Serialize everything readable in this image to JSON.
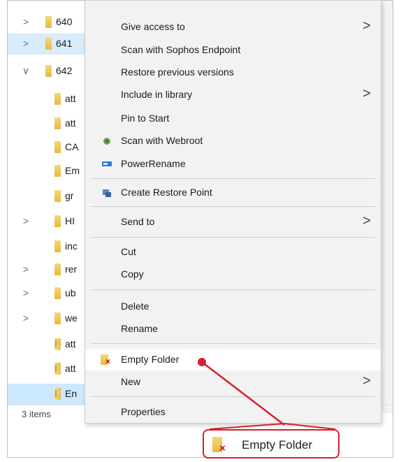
{
  "explorer": {
    "tree": [
      {
        "label": "640",
        "chevron": ">",
        "icon": "folder-icon",
        "indent": 0
      },
      {
        "label": "641",
        "chevron": ">",
        "icon": "folder-icon",
        "indent": 0
      },
      {
        "label": "642",
        "chevron": "∨",
        "icon": "folder-icon",
        "indent": 0
      },
      {
        "label": "att",
        "chevron": "",
        "icon": "folder-icon",
        "indent": 1
      },
      {
        "label": "att",
        "chevron": "",
        "icon": "folder-icon",
        "indent": 1
      },
      {
        "label": "CA",
        "chevron": "",
        "icon": "folder-icon",
        "indent": 1
      },
      {
        "label": "Em",
        "chevron": "",
        "icon": "folder-icon",
        "indent": 1
      },
      {
        "label": "gr",
        "chevron": "",
        "icon": "folder-icon",
        "indent": 1
      },
      {
        "label": "HI",
        "chevron": ">",
        "icon": "folder-icon",
        "indent": 1
      },
      {
        "label": "inc",
        "chevron": "",
        "icon": "folder-icon",
        "indent": 1
      },
      {
        "label": "rer",
        "chevron": ">",
        "icon": "folder-icon",
        "indent": 1
      },
      {
        "label": "ub",
        "chevron": ">",
        "icon": "folder-icon",
        "indent": 1
      },
      {
        "label": "we",
        "chevron": ">",
        "icon": "folder-icon",
        "indent": 1
      },
      {
        "label": "att",
        "chevron": "",
        "icon": "zip-folder-icon",
        "indent": 1
      },
      {
        "label": "att",
        "chevron": "",
        "icon": "zip-folder-icon",
        "indent": 1
      },
      {
        "label": "En",
        "chevron": "",
        "icon": "zip-folder-icon",
        "indent": 1
      }
    ],
    "status": "3 items"
  },
  "context_menu": {
    "items": [
      {
        "label": "Give access to",
        "submenu": true,
        "icon": ""
      },
      {
        "label": "Scan with Sophos Endpoint",
        "submenu": false,
        "icon": ""
      },
      {
        "label": "Restore previous versions",
        "submenu": false,
        "icon": ""
      },
      {
        "label": "Include in library",
        "submenu": true,
        "icon": ""
      },
      {
        "label": "Pin to Start",
        "submenu": false,
        "icon": ""
      },
      {
        "label": "Scan with Webroot",
        "submenu": false,
        "icon": "webroot-icon"
      },
      {
        "label": "PowerRename",
        "submenu": false,
        "icon": "powerrename-icon"
      },
      {
        "label": "Create Restore Point",
        "submenu": false,
        "icon": "restore-point-icon"
      },
      {
        "label": "Send to",
        "submenu": true,
        "icon": ""
      },
      {
        "label": "Cut",
        "submenu": false,
        "icon": ""
      },
      {
        "label": "Copy",
        "submenu": false,
        "icon": ""
      },
      {
        "label": "Delete",
        "submenu": false,
        "icon": ""
      },
      {
        "label": "Rename",
        "submenu": false,
        "icon": ""
      },
      {
        "label": "Empty Folder",
        "submenu": false,
        "icon": "empty-folder-icon"
      },
      {
        "label": "New",
        "submenu": true,
        "icon": ""
      },
      {
        "label": "Properties",
        "submenu": false,
        "icon": ""
      }
    ],
    "submenu_arrow": ">"
  },
  "callout": {
    "label": "Empty Folder",
    "icon": "empty-folder-icon",
    "x_mark": "×"
  },
  "colors": {
    "accent_red": "#d5202e",
    "selection_blue": "#cce8ff",
    "folder_yellow": "#e7b93e"
  }
}
